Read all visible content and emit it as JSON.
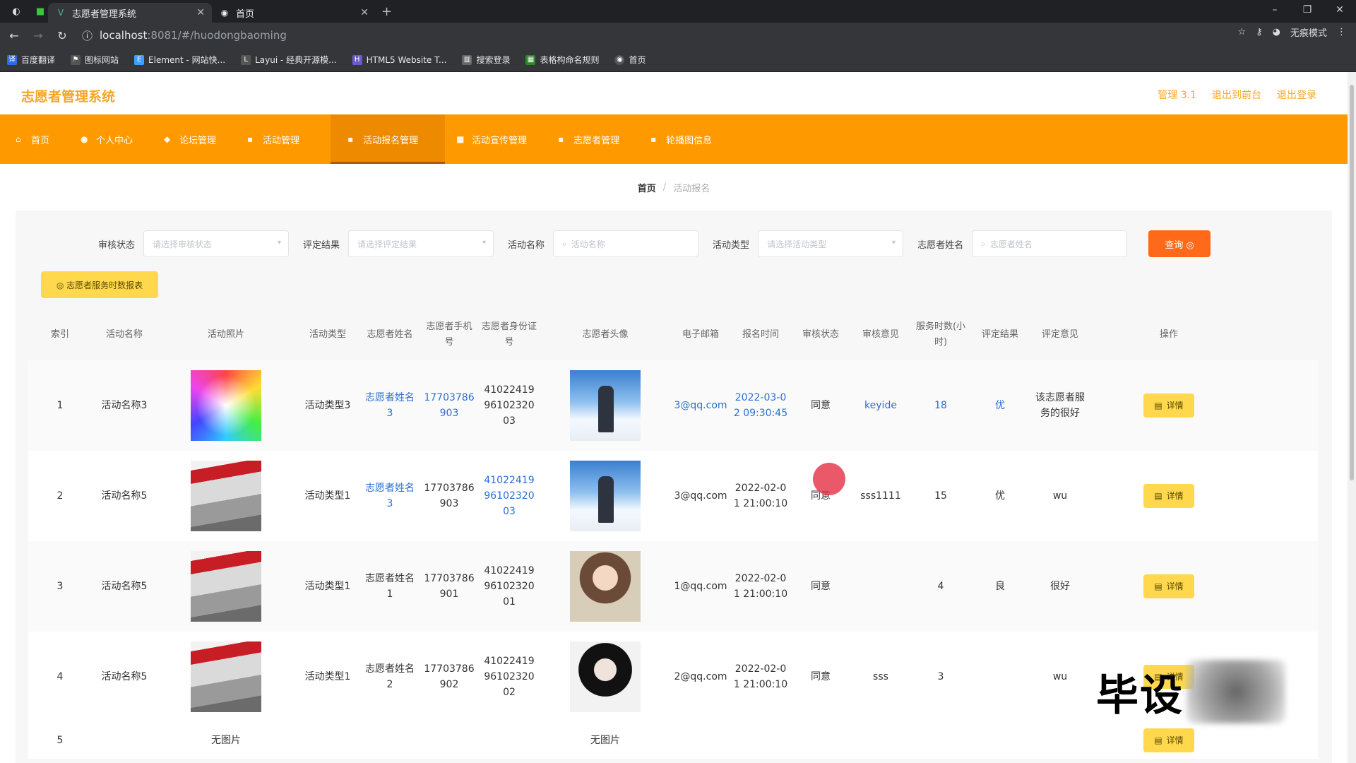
{
  "browser": {
    "tabs": [
      {
        "title": "志愿者管理系统",
        "active": true
      },
      {
        "title": "首页",
        "active": false
      }
    ],
    "url_host": "localhost",
    "url_path": ":8081/#/huodongbaoming",
    "profile_label": "无痕模式",
    "bookmarks": [
      "百度翻译",
      "图标网站",
      "Element - 网站快...",
      "Layui - 经典开源模...",
      "HTML5 Website T...",
      "搜索登录",
      "表格构命名规则",
      "首页"
    ]
  },
  "app": {
    "logo": "志愿者管理系统",
    "header_links": [
      "管理 3.1",
      "退出到前台",
      "退出登录"
    ],
    "nav": [
      "首页",
      "个人中心",
      "论坛管理",
      "活动管理",
      "活动报名管理",
      "活动宣传管理",
      "志愿者管理",
      "轮播图信息"
    ],
    "active_nav": "活动报名管理",
    "breadcrumb": {
      "home": "首页",
      "current": "活动报名"
    }
  },
  "filters": {
    "fields": [
      {
        "label": "审核状态",
        "placeholder": "请选择审核状态"
      },
      {
        "label": "评定结果",
        "placeholder": "请选择评定结果"
      },
      {
        "label": "活动名称",
        "placeholder": "活动名称"
      },
      {
        "label": "活动类型",
        "placeholder": "请选择活动类型"
      },
      {
        "label": "志愿者姓名",
        "placeholder": "志愿者姓名"
      }
    ],
    "search_label": "查询 ◎",
    "report_label": "◎ 志愿者服务时数报表"
  },
  "table": {
    "headers": [
      "索引",
      "活动名称",
      "活动照片",
      "活动类型",
      "志愿者姓名",
      "志愿者手机号",
      "志愿者身份证号",
      "志愿者头像",
      "电子邮箱",
      "报名时间",
      "审核状态",
      "审核意见",
      "服务时数(小时)",
      "评定结果",
      "评定意见",
      "操作"
    ],
    "detail_label": "详情",
    "no_image": "无图片",
    "rows": [
      {
        "index": "1",
        "name": "活动名称3",
        "photo": "color",
        "type": "活动类型3",
        "volunteer": "志愿者姓名3",
        "phone": "17703786903",
        "id": "410224199610232003",
        "avatar": "sky",
        "email": "3@qq.com",
        "time": "2022-03-02 09:30:45",
        "status": "同意",
        "opinion": "keyide",
        "hours": "18",
        "result": "优",
        "comment": "该志愿者服务的很好"
      },
      {
        "index": "2",
        "name": "活动名称5",
        "photo": "event",
        "type": "活动类型1",
        "volunteer": "志愿者姓名3",
        "phone": "17703786903",
        "id": "410224199610232003",
        "avatar": "sky",
        "email": "3@qq.com",
        "time": "2022-02-01 21:00:10",
        "status": "同意",
        "opinion": "sss1111",
        "hours": "15",
        "result": "优",
        "comment": "wu"
      },
      {
        "index": "3",
        "name": "活动名称5",
        "photo": "event",
        "type": "活动类型1",
        "volunteer": "志愿者姓名1",
        "phone": "17703786901",
        "id": "410224199610232001",
        "avatar": "girl1",
        "email": "1@qq.com",
        "time": "2022-02-01 21:00:10",
        "status": "同意",
        "opinion": "",
        "hours": "4",
        "result": "良",
        "comment": "很好"
      },
      {
        "index": "4",
        "name": "活动名称5",
        "photo": "event",
        "type": "活动类型1",
        "volunteer": "志愿者姓名2",
        "phone": "17703786902",
        "id": "410224199610232002",
        "avatar": "girl2",
        "email": "2@qq.com",
        "time": "2022-02-01 21:00:10",
        "status": "同意",
        "opinion": "sss",
        "hours": "3",
        "result": "",
        "comment": "wu"
      }
    ],
    "row5_index": "5"
  },
  "watermark": "毕设",
  "colors": {
    "accent": "#ff9900",
    "logo": "#f5a623",
    "button_yellow": "#ffd84d",
    "search_orange": "#ff6a1a",
    "link_blue": "#2a6fd6"
  }
}
